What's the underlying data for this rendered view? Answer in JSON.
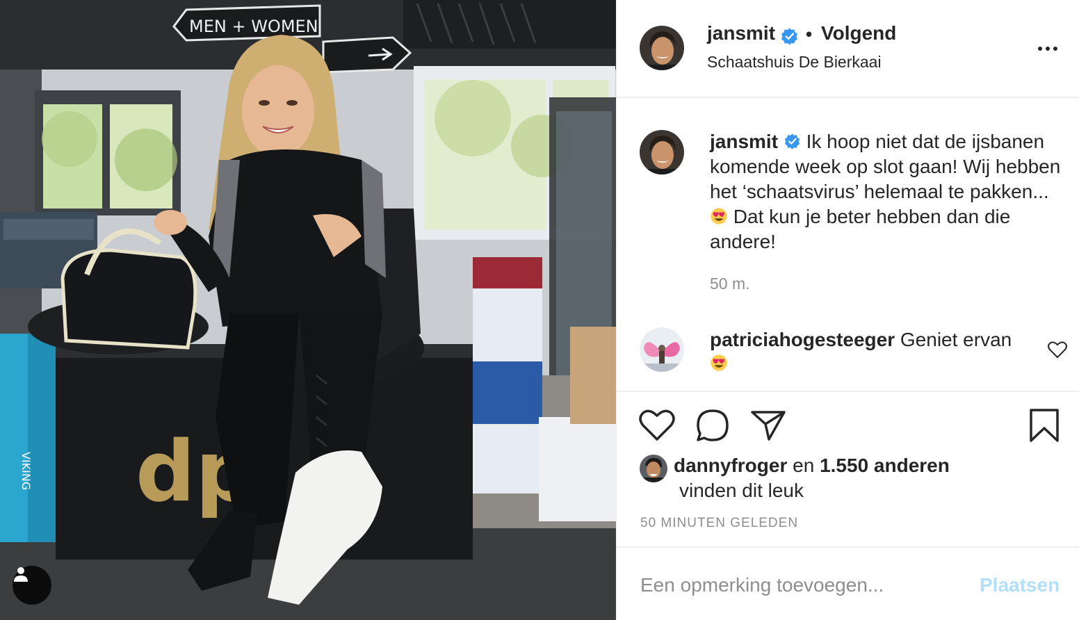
{
  "post": {
    "author": "jansmit",
    "follow_status": "Volgend",
    "location": "Schaatshuis De Bierkaai",
    "photo_signs": {
      "men_women": "MEN + WOMEN"
    }
  },
  "caption": {
    "username": "jansmit",
    "text_part1": "Ik hoop niet dat de ijsbanen komende week op slot gaan! Wij hebben het ‘schaatsvirus’ helemaal te pakken...",
    "text_part2": "Dat kun je beter hebben dan die andere!",
    "time": "50 m."
  },
  "comments": [
    {
      "username": "patriciahogesteeger",
      "text": "Geniet ervan"
    }
  ],
  "likes": {
    "first_user": "dannyfroger",
    "connector": "en",
    "others": "1.550 anderen",
    "suffix": "vinden dit leuk"
  },
  "timestamp": "50 MINUTEN GELEDEN",
  "comment_box": {
    "placeholder": "Een opmerking toevoegen...",
    "submit_label": "Plaatsen"
  },
  "icons": {
    "verified": "verified-badge-icon",
    "more": "more-options-icon",
    "like": "heart-icon",
    "comment": "comment-bubble-icon",
    "share": "paper-plane-icon",
    "save": "bookmark-icon",
    "user_tag": "user-tag-icon",
    "emoji": "heart-eyes-emoji"
  },
  "colors": {
    "verified_blue": "#3897f0",
    "post_button_disabled": "#b2dffc",
    "secondary_text": "#8e8e8e",
    "border": "#efefef"
  }
}
